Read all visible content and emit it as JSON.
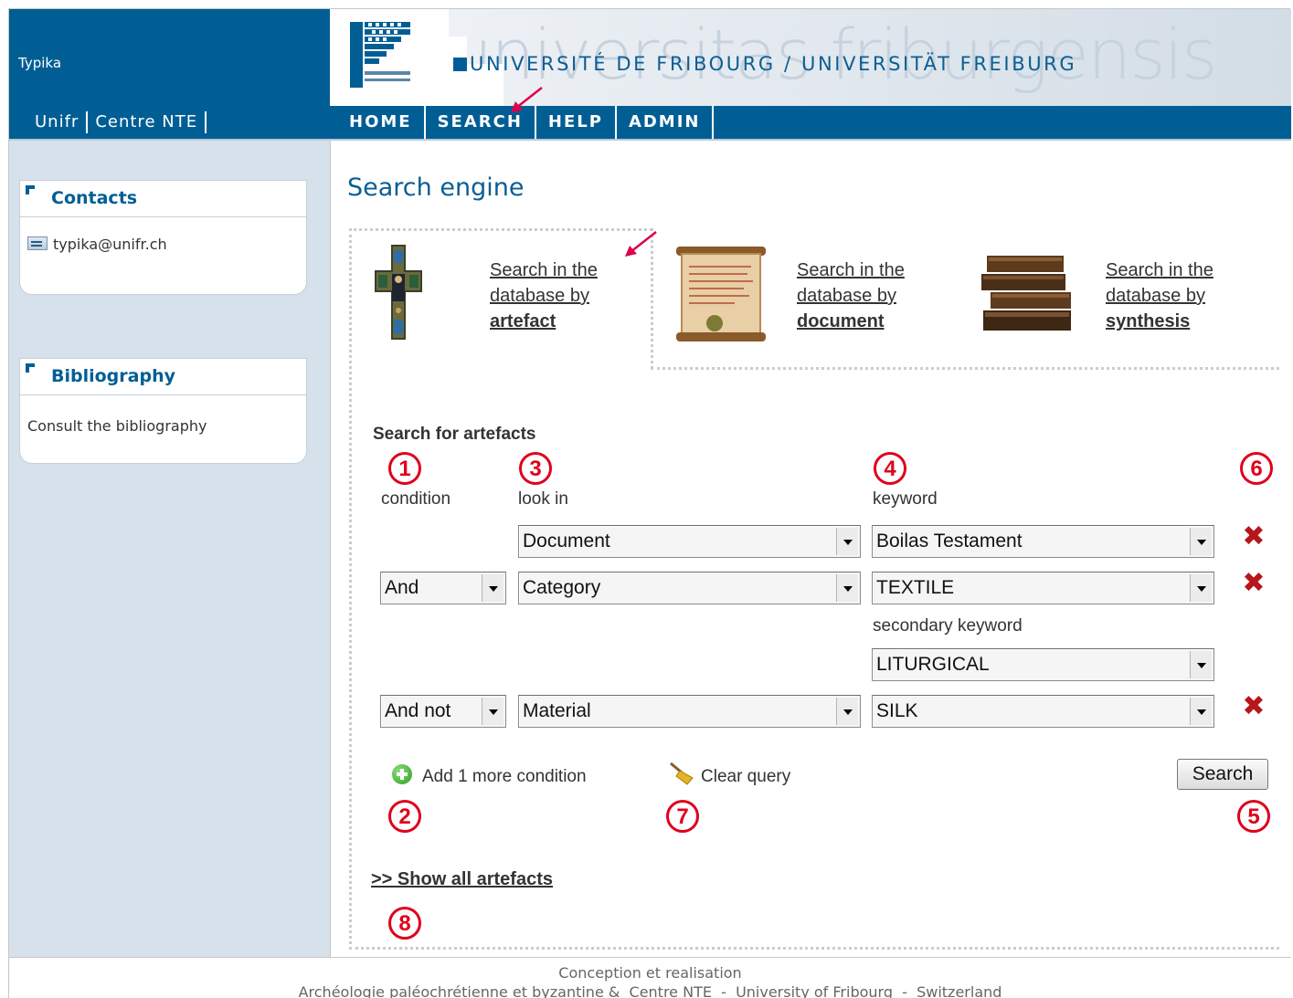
{
  "header": {
    "site_name": "Typika",
    "university_title": "UNIVERSITÉ DE FRIBOURG / UNIVERSITÄT FREIBURG",
    "watermark": "universitas friburgensis",
    "logo_icon": "university-logo"
  },
  "subnav": [
    "Unifr",
    "Centre NTE"
  ],
  "nav": {
    "tabs": [
      "HOME",
      "SEARCH",
      "HELP",
      "ADMIN"
    ],
    "active": "SEARCH"
  },
  "sidebar": {
    "contacts": {
      "title": "Contacts",
      "email": "typika@unifr.ch"
    },
    "bibliography": {
      "title": "Bibliography",
      "link": "Consult the bibliography"
    }
  },
  "main": {
    "title": "Search engine",
    "search_options": [
      {
        "line1": "Search in the",
        "line2": "database by",
        "line3": "artefact"
      },
      {
        "line1": "Search in the",
        "line2": "database by",
        "line3": "document"
      },
      {
        "line1": "Search in the",
        "line2": "database by",
        "line3": "synthesis"
      }
    ],
    "form": {
      "heading": "Search for artefacts",
      "col_condition": "condition",
      "col_look_in": "look in",
      "col_keyword": "keyword",
      "secondary_keyword_label": "secondary keyword",
      "rows": [
        {
          "condition": "",
          "look_in": "Document",
          "keyword": "Boilas Testament"
        },
        {
          "condition": "And",
          "look_in": "Category",
          "keyword": "TEXTILE",
          "secondary": "LITURGICAL"
        },
        {
          "condition": "And not",
          "look_in": "Material",
          "keyword": "SILK"
        }
      ],
      "add_condition": "Add 1 more condition",
      "clear_query": "Clear query",
      "search_button": "Search",
      "show_all": ">> Show all artefacts"
    },
    "annotations": [
      "1",
      "2",
      "3",
      "4",
      "5",
      "6",
      "7",
      "8"
    ]
  },
  "footer": {
    "line1": "Conception et realisation",
    "line2": "Archéologie paléochrétienne et byzantine &  Centre NTE  -  University of Fribourg  -  Switzerland"
  },
  "colors": {
    "brand_blue": "#005e95",
    "sidebar_bg": "#d7e1eb",
    "annotation_red": "#e0001a",
    "delete_red": "#b7161b"
  }
}
